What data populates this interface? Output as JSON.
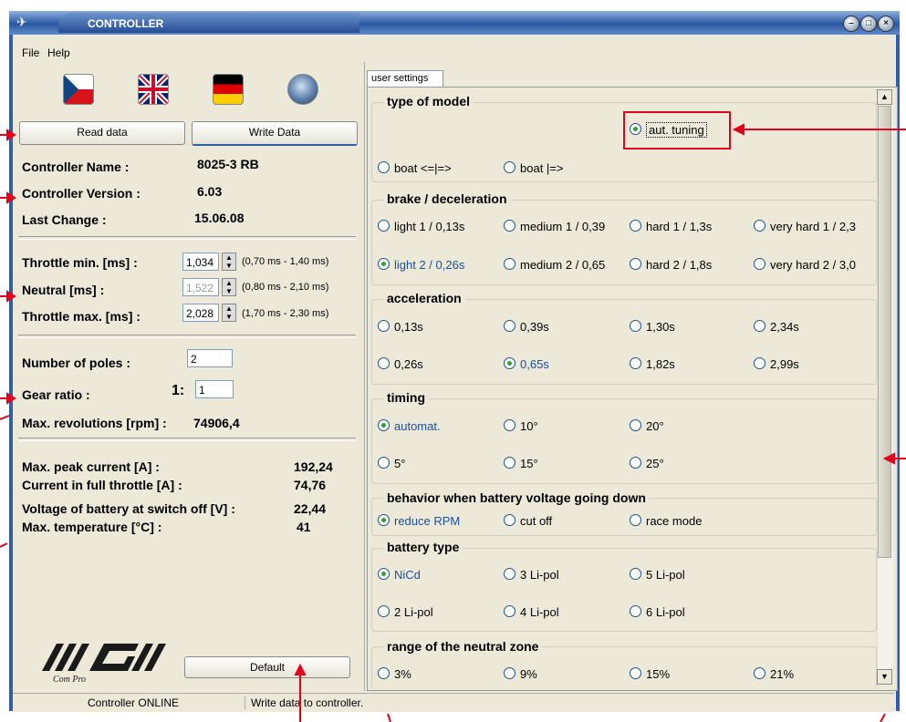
{
  "window": {
    "title": "CONTROLLER",
    "controls": [
      "minimize",
      "maximize",
      "close"
    ]
  },
  "menu": {
    "file": "File",
    "help": "Help"
  },
  "flags": [
    {
      "name": "czech-flag-icon"
    },
    {
      "name": "uk-flag-icon"
    },
    {
      "name": "german-flag-icon"
    },
    {
      "name": "globe-icon"
    }
  ],
  "buttons": {
    "read": "Read data",
    "write": "Write Data",
    "default": "Default"
  },
  "info": {
    "name_label": "Controller Name :",
    "name_value": "8025-3 RB",
    "version_label": "Controller Version :",
    "version_value": "6.03",
    "change_label": "Last Change :",
    "change_value": "15.06.08"
  },
  "throttle": {
    "min_label": "Throttle min. [ms] :",
    "min_value": "1,034",
    "min_range": "(0,70 ms - 1,40 ms)",
    "neutral_label": "Neutral [ms] :",
    "neutral_value": "1,522",
    "neutral_range": "(0,80 ms - 2,10 ms)",
    "max_label": "Throttle max. [ms] :",
    "max_value": "2,028",
    "max_range": "(1,70 ms - 2,30 ms)"
  },
  "motor": {
    "poles_label": "Number of poles :",
    "poles_value": "2",
    "gear_label": "Gear ratio :",
    "gear_prefix": "1:",
    "gear_value": "1",
    "maxrev_label": "Max. revolutions [rpm] :",
    "maxrev_value": "74906,4"
  },
  "stats": {
    "peak_label": "Max. peak current [A] :",
    "peak_value": "192,24",
    "full_label": "Current in full throttle [A] :",
    "full_value": "74,76",
    "volt_label": "Voltage of battery at switch off [V] :",
    "volt_value": "22,44",
    "temp_label": "Max. temperature [°C] :",
    "temp_value": "41"
  },
  "logo": {
    "brand": "MGM",
    "sub": "Com Pro"
  },
  "tab": "user settings",
  "groups": {
    "model": {
      "title": "type of model",
      "aut": "aut. tuning",
      "opts": [
        "boat  <=|=>",
        "boat  |=>"
      ]
    },
    "brake": {
      "title": "brake / deceleration",
      "row1": [
        "light 1 / 0,13s",
        "medium 1 / 0,39",
        "hard 1 / 1,3s",
        "very hard 1 / 2,3"
      ],
      "row2": [
        "light 2  / 0,26s",
        "medium 2 / 0,65",
        "hard 2 / 1,8s",
        "very hard 2 / 3,0"
      ]
    },
    "accel": {
      "title": "acceleration",
      "row1": [
        "0,13s",
        "0,39s",
        "1,30s",
        "2,34s"
      ],
      "row2": [
        "0,26s",
        "0,65s",
        "1,82s",
        "2,99s"
      ]
    },
    "timing": {
      "title": "timing",
      "row1": [
        "automat.",
        "10°",
        "20°"
      ],
      "row2": [
        "5°",
        "15°",
        "25°"
      ]
    },
    "behavior": {
      "title": "behavior when battery voltage going down",
      "opts": [
        "reduce RPM",
        "cut off",
        "race mode"
      ]
    },
    "battery": {
      "title": "battery type",
      "row1": [
        "NiCd",
        "3 Li-pol",
        "5 Li-pol"
      ],
      "row2": [
        "2 Li-pol",
        "4 Li-pol",
        "6 Li-pol"
      ]
    },
    "neutralzone": {
      "title": "range of the neutral zone",
      "opts": [
        "3%",
        "9%",
        "15%",
        "21%"
      ]
    }
  },
  "status": {
    "online": "Controller ONLINE",
    "message": "Write data to controller."
  }
}
